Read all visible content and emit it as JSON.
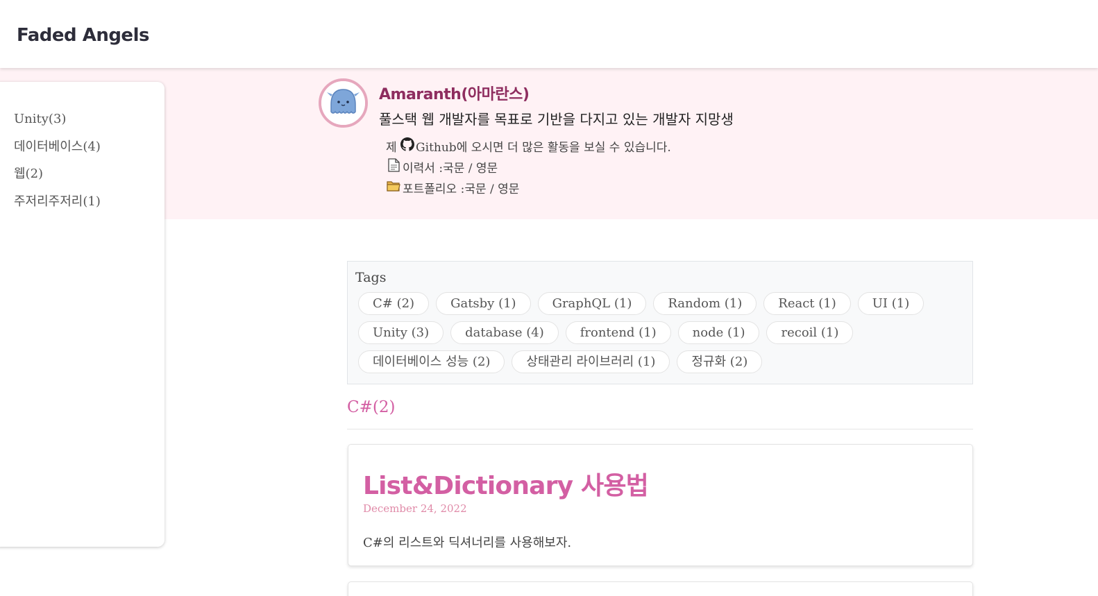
{
  "site": {
    "title": "Faded Angels"
  },
  "bio": {
    "name": "Amaranth(아마란스)",
    "description": "풀스택 웹 개발자를 목표로 기반을 다지고 있는 개발자 지망생",
    "github_prefix": "제",
    "github_link": "Github",
    "github_suffix": "에 오시면 더 많은 활동을 보실 수 있습니다.",
    "resume_label": "이력서 : ",
    "resume_kor": "국문",
    "resume_eng": "영문",
    "portfolio_label": "포트폴리오 : ",
    "portfolio_kor": "국문",
    "portfolio_eng": "영문",
    "separator": " / ",
    "icons": {
      "avatar": "jellyfish-avatar",
      "github": "github-icon",
      "resume": "document-icon",
      "portfolio": "folder-icon"
    }
  },
  "sidebar": {
    "categories": [
      {
        "label": "Unity(3)"
      },
      {
        "label": "데이터베이스(4)"
      },
      {
        "label": "웹(2)"
      },
      {
        "label": "주저리주저리(1)"
      }
    ]
  },
  "tags": {
    "title": "Tags",
    "rows": [
      [
        "C# (2)",
        "Gatsby (1)",
        "GraphQL (1)",
        "Random (1)",
        "React (1)",
        "UI (1)"
      ],
      [
        "Unity (3)",
        "database (4)",
        "frontend (1)",
        "node (1)",
        "recoil (1)"
      ],
      [
        "데이터베이스 성능 (2)",
        "상태관리 라이브러리 (1)",
        "정규화 (2)"
      ]
    ]
  },
  "category": {
    "heading": "C#(2)"
  },
  "posts": [
    {
      "title": "List&Dictionary 사용법",
      "date": "December 24, 2022",
      "description": "C#의 리스트와 딕셔너리를 사용해보자."
    }
  ],
  "colors": {
    "accent": "#d35fa3",
    "name": "#8e2d5f",
    "bio_bg": "#fff2f5",
    "date": "#e08aa8",
    "avatar_border": "#e6a7bd"
  }
}
